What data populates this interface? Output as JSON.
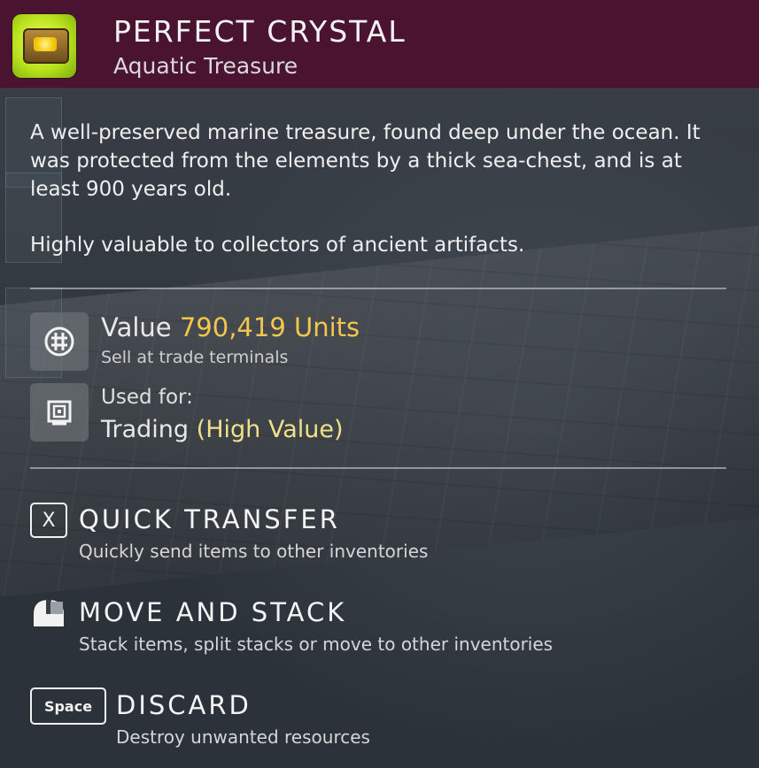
{
  "item": {
    "title": "PERFECT CRYSTAL",
    "category": "Aquatic Treasure",
    "icon": "treasure-chest-icon"
  },
  "description": {
    "paragraph1": "A well-preserved marine treasure, found deep under the ocean. It was protected from the elements by a thick sea-chest, and is at least 900 years old.",
    "paragraph2": "Highly valuable to collectors of ancient artifacts."
  },
  "value": {
    "label": "Value",
    "amount": "790,419 Units",
    "note": "Sell at trade terminals",
    "icon": "units-currency-icon"
  },
  "usage": {
    "label": "Used for:",
    "value": "Trading",
    "qualifier": "(High Value)",
    "icon": "trade-terminal-icon"
  },
  "actions": [
    {
      "key": "X",
      "title": "QUICK TRANSFER",
      "subtitle": "Quickly send items to other inventories"
    },
    {
      "key": "mouse-icon",
      "title": "MOVE AND STACK",
      "subtitle": "Stack items, split stacks or move to other inventories"
    },
    {
      "key": "Space",
      "title": "DISCARD",
      "subtitle": "Destroy unwanted resources"
    }
  ],
  "colors": {
    "header_bg": "#4a1430",
    "value_accent": "#f3c74d",
    "highlight_accent": "#f0e08a",
    "item_icon_bg": "#b8e21c"
  }
}
